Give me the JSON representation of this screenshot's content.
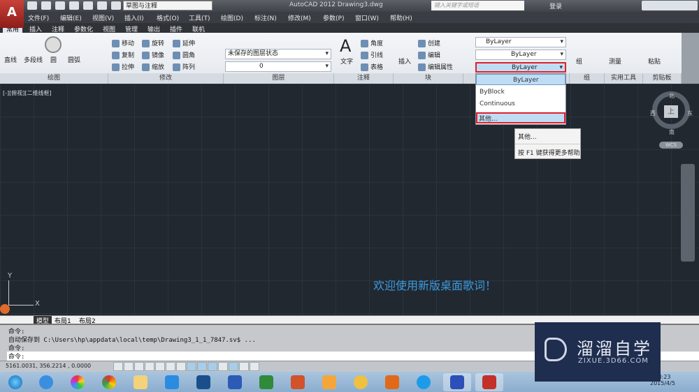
{
  "title_bar": {
    "app_title": "AutoCAD 2012    Drawing3.dwg",
    "workspace": "草图与注释",
    "search_placeholder": "键入关键字或短语",
    "login": "登录"
  },
  "menu": [
    "文件(F)",
    "编辑(E)",
    "视图(V)",
    "插入(I)",
    "格式(O)",
    "工具(T)",
    "绘图(D)",
    "标注(N)",
    "修改(M)",
    "参数(P)",
    "窗口(W)",
    "帮助(H)"
  ],
  "ribbon_tabs": [
    "常用",
    "插入",
    "注释",
    "参数化",
    "视图",
    "管理",
    "输出",
    "插件",
    "联机"
  ],
  "draw_panel": {
    "label": "绘图",
    "tools": [
      "直线",
      "多段线",
      "圆",
      "圆弧"
    ]
  },
  "modify_panel": {
    "label": "修改",
    "tools": [
      "移动",
      "旋转",
      "延伸",
      "复制",
      "镜像",
      "圆角",
      "拉伸",
      "缩放",
      "阵列"
    ]
  },
  "layer_panel": {
    "label": "图层",
    "layer_state": "未保存的图层状态",
    "current_layer": "0"
  },
  "annotation_panel": {
    "label": "注释",
    "text": "文字",
    "tools": [
      "角度",
      "引线",
      "表格"
    ]
  },
  "block_panel": {
    "label": "块",
    "insert": "插入",
    "tools": [
      "创建",
      "编辑",
      "编辑属性"
    ]
  },
  "properties_panel": {
    "color": "ByLayer",
    "lineweight": "ByLayer",
    "linetype": "ByLayer"
  },
  "group_panel": {
    "label": "组",
    "tool": "组"
  },
  "utilities_panel": {
    "label": "实用工具",
    "tool": "测量"
  },
  "clipboard_panel": {
    "label": "剪贴板",
    "tool": "粘贴"
  },
  "linetype_dropdown": {
    "items": [
      "ByLayer",
      "ByBlock",
      "Continuous",
      "其他..."
    ],
    "highlight_color": "#e0202a"
  },
  "context_tooltip": {
    "items": [
      "其他...",
      "按 F1 键获得更多帮助"
    ]
  },
  "viewport": {
    "label": "[-][俯视][二维线框]",
    "welcome": "欢迎使用新版桌面歌词！",
    "compass": {
      "north": "北",
      "south": "南",
      "east": "东",
      "west": "西",
      "top": "上"
    },
    "wcs": "WCS",
    "axis_x": "X",
    "axis_y": "Y"
  },
  "layout_tabs": [
    "模型",
    "布局1",
    "布局2"
  ],
  "command_history": [
    "命令:",
    "自动保存到 C:\\Users\\hp\\appdata\\local\\temp\\Drawing3_1_1_7847.sv$ ...",
    "命令:"
  ],
  "command_prompt": "命令:",
  "status": {
    "coordinates": "5161.0031, 356.2214 , 0.0000"
  },
  "taskbar": {
    "time": "23:23",
    "date": "2015/4/5"
  },
  "watermark": {
    "name": "溜溜自学",
    "url": "ZIXUE.3D66.COM"
  }
}
